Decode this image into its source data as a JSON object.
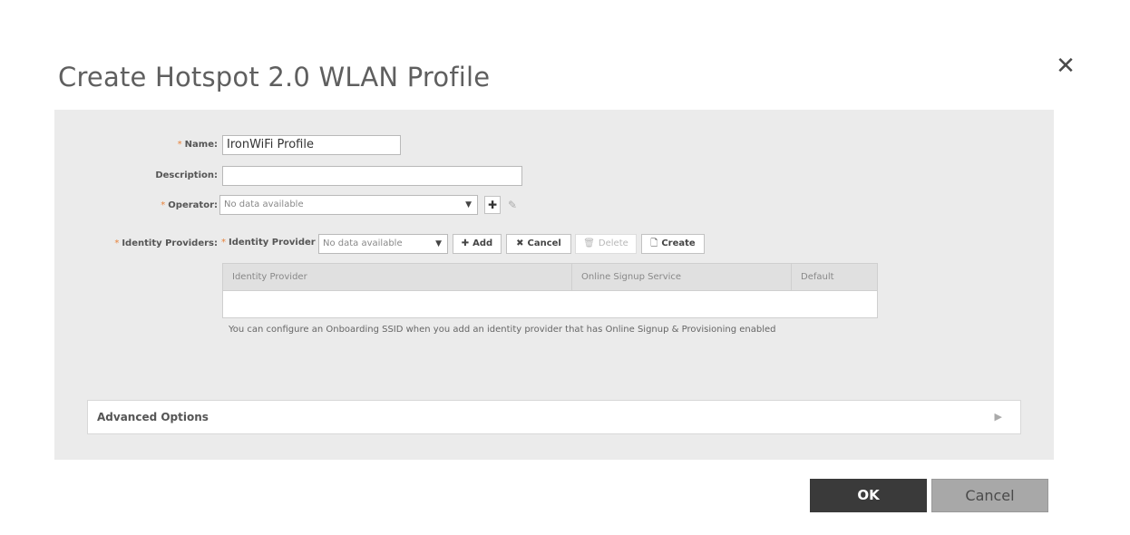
{
  "dialog": {
    "title": "Create Hotspot 2.0 WLAN Profile",
    "close_symbol": "✕"
  },
  "form": {
    "name_label": "Name:",
    "name_value": "IronWiFi Profile",
    "description_label": "Description:",
    "description_value": "",
    "operator_label": "Operator:",
    "operator_value": "No data available",
    "identity_providers_label": "Identity Providers:",
    "identity_provider_sublabel": "Identity Provider",
    "identity_provider_value": "No data available",
    "required_mark": "*"
  },
  "toolbar": {
    "add_label": "Add",
    "cancel_label": "Cancel",
    "delete_label": "Delete",
    "create_label": "Create"
  },
  "table": {
    "columns": [
      "Identity Provider",
      "Online Signup Service",
      "Default"
    ],
    "rows": []
  },
  "hint": "You can configure an Onboarding SSID when you add an identity provider that has Online Signup & Provisioning enabled",
  "advanced": {
    "label": "Advanced Options"
  },
  "footer": {
    "ok_label": "OK",
    "cancel_label": "Cancel"
  },
  "icons": {
    "plus": "✚",
    "x": "✖",
    "trash": "🗑",
    "document": "🗋",
    "pencil": "✎",
    "dropdown": "▼",
    "expand": "▶"
  },
  "colors": {
    "required": "#e8823a",
    "ok_button": "#3a3a3a",
    "cancel_button": "#a8a8a8",
    "panel": "#ebebeb"
  }
}
